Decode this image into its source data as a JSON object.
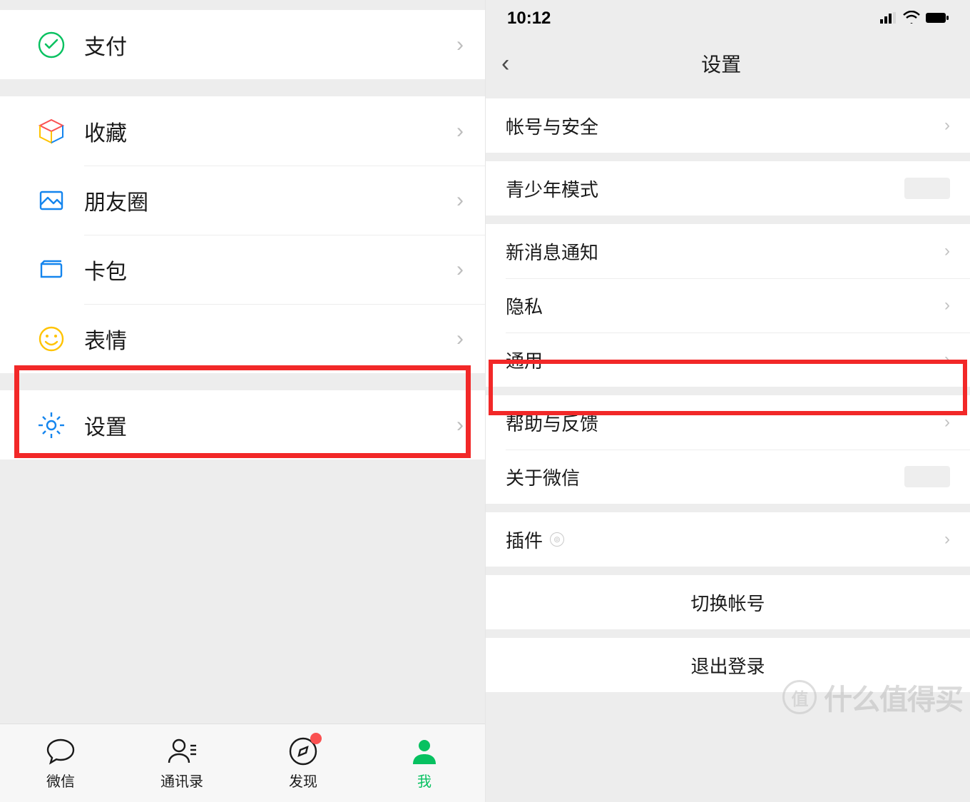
{
  "left": {
    "items": {
      "pay": {
        "label": "支付"
      },
      "fav": {
        "label": "收藏"
      },
      "moments": {
        "label": "朋友圈"
      },
      "cards": {
        "label": "卡包"
      },
      "stickers": {
        "label": "表情"
      },
      "settings": {
        "label": "设置"
      }
    },
    "tabs": {
      "chats": {
        "label": "微信"
      },
      "contacts": {
        "label": "通讯录"
      },
      "discover": {
        "label": "发现",
        "badge": true
      },
      "me": {
        "label": "我",
        "active": true
      }
    },
    "highlight": "settings"
  },
  "right": {
    "status": {
      "time": "10:12"
    },
    "nav": {
      "title": "设置"
    },
    "items": {
      "account": {
        "label": "帐号与安全"
      },
      "teen": {
        "label": "青少年模式"
      },
      "newmsg": {
        "label": "新消息通知"
      },
      "privacy": {
        "label": "隐私"
      },
      "general": {
        "label": "通用"
      },
      "help": {
        "label": "帮助与反馈"
      },
      "about": {
        "label": "关于微信"
      },
      "plugins": {
        "label": "插件"
      },
      "switch": {
        "label": "切换帐号"
      },
      "logout": {
        "label": "退出登录"
      }
    },
    "highlight": "help"
  },
  "watermark": {
    "text": "什么值得买",
    "badge": "值"
  }
}
